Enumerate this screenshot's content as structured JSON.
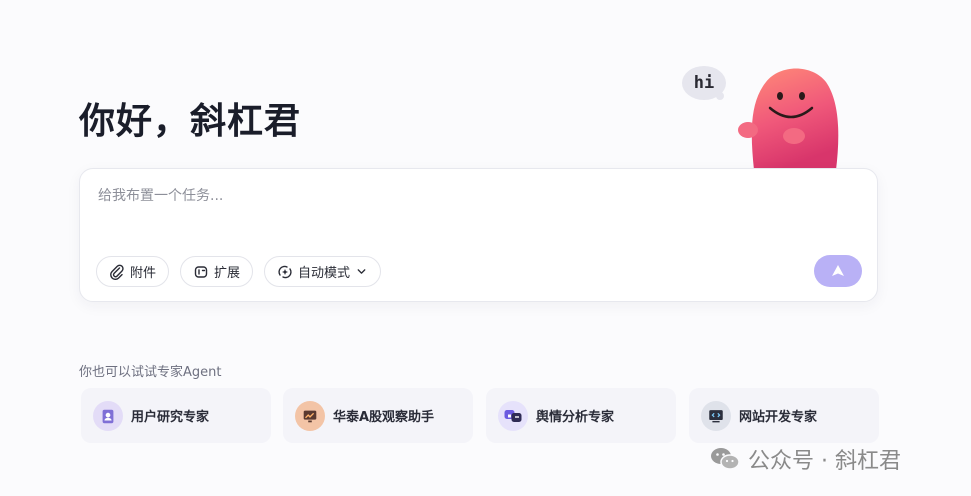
{
  "greeting": "你好，斜杠君",
  "mascot": {
    "bubble_text": "hi"
  },
  "task": {
    "placeholder": "给我布置一个任务...",
    "attach_label": "附件",
    "extend_label": "扩展",
    "mode_label": "自动模式"
  },
  "agents": {
    "label": "你也可以试试专家Agent",
    "items": [
      {
        "name": "用户研究专家",
        "icon": "user-research-icon"
      },
      {
        "name": "华泰A股观察助手",
        "icon": "stock-chart-icon"
      },
      {
        "name": "舆情分析专家",
        "icon": "sentiment-icon"
      },
      {
        "name": "网站开发专家",
        "icon": "code-monitor-icon"
      }
    ]
  },
  "watermark": "公众号 · 斜杠君",
  "colors": {
    "accent": "#b9b1f6",
    "mascot": "#f0587a"
  }
}
